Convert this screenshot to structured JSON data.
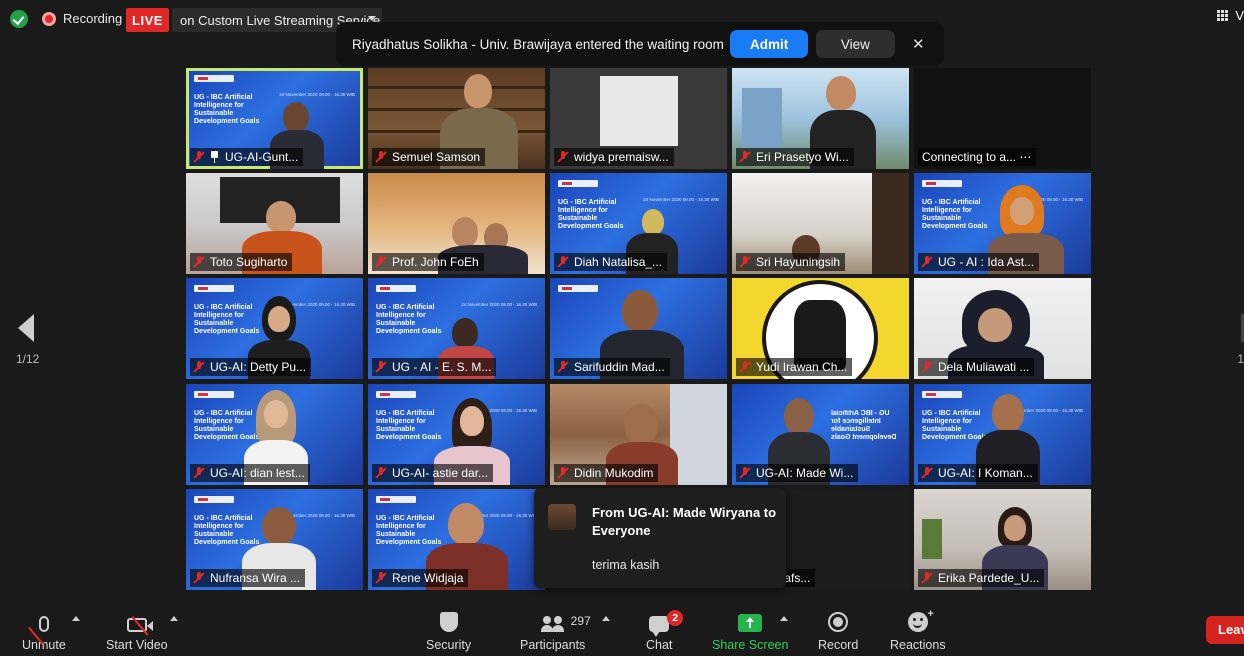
{
  "status": {
    "recording_label": "Recording",
    "live_badge": "LIVE",
    "live_service": "on Custom Live Streaming Service",
    "view_label": "V"
  },
  "notification": {
    "message": "Riyadhatus Solikha - Univ. Brawijaya entered the waiting room",
    "admit_label": "Admit",
    "view_label": "View",
    "close_icon": "✕"
  },
  "pagination": {
    "left_page": "1/12",
    "right_page": "1"
  },
  "participants": [
    {
      "name": "UG-AI-Gunt...",
      "muted": true,
      "pinned": true,
      "active": true
    },
    {
      "name": "Semuel Samson",
      "muted": true
    },
    {
      "name": "widya premaisw...",
      "muted": true
    },
    {
      "name": "Eri Prasetyo Wi...",
      "muted": true
    },
    {
      "name": "Connecting to a... ⋯",
      "muted": false
    },
    {
      "name": "Toto Sugiharto",
      "muted": true
    },
    {
      "name": "Prof. John FoEh",
      "muted": true
    },
    {
      "name": "Diah Natalisa_...",
      "muted": true
    },
    {
      "name": "Sri Hayuningsih",
      "muted": true
    },
    {
      "name": "UG - AI : Ida Ast...",
      "muted": true
    },
    {
      "name": "UG-AI: Detty Pu...",
      "muted": true
    },
    {
      "name": "UG - AI - E. S. M...",
      "muted": true
    },
    {
      "name": "Sarifuddin Mad...",
      "muted": true
    },
    {
      "name": "Yudi Irawan Ch...",
      "muted": true
    },
    {
      "name": "Dela Muliawati ...",
      "muted": true
    },
    {
      "name": "UG-AI: dian lest...",
      "muted": true
    },
    {
      "name": "UG-AI- astie dar...",
      "muted": true
    },
    {
      "name": "Didin Mukodim",
      "muted": true
    },
    {
      "name": "UG-AI: Made Wi...",
      "muted": true
    },
    {
      "name": "UG-AI: I Koman...",
      "muted": true
    },
    {
      "name": "Nufransa Wira ...",
      "muted": true
    },
    {
      "name": "Rene Widjaja",
      "muted": true
    },
    {
      "name": "...warti Rafs...",
      "muted": false
    },
    {
      "name": "Erika Pardede_U...",
      "muted": true
    }
  ],
  "slide": {
    "title": "UG - IBC Artificial Intelligence for Sustainable Development Goals",
    "date": "24 November 2020 09.00 - 16.30 WIB"
  },
  "chat_popup": {
    "from": "From UG-AI: Made Wiryana to Everyone",
    "message": "terima kasih"
  },
  "toolbar": {
    "unmute": "Unmute",
    "start_video": "Start Video",
    "security": "Security",
    "participants": "Participants",
    "participant_count": "297",
    "chat": "Chat",
    "chat_badge": "2",
    "share_screen": "Share Screen",
    "record": "Record",
    "reactions": "Reactions",
    "leave": "Leave"
  }
}
